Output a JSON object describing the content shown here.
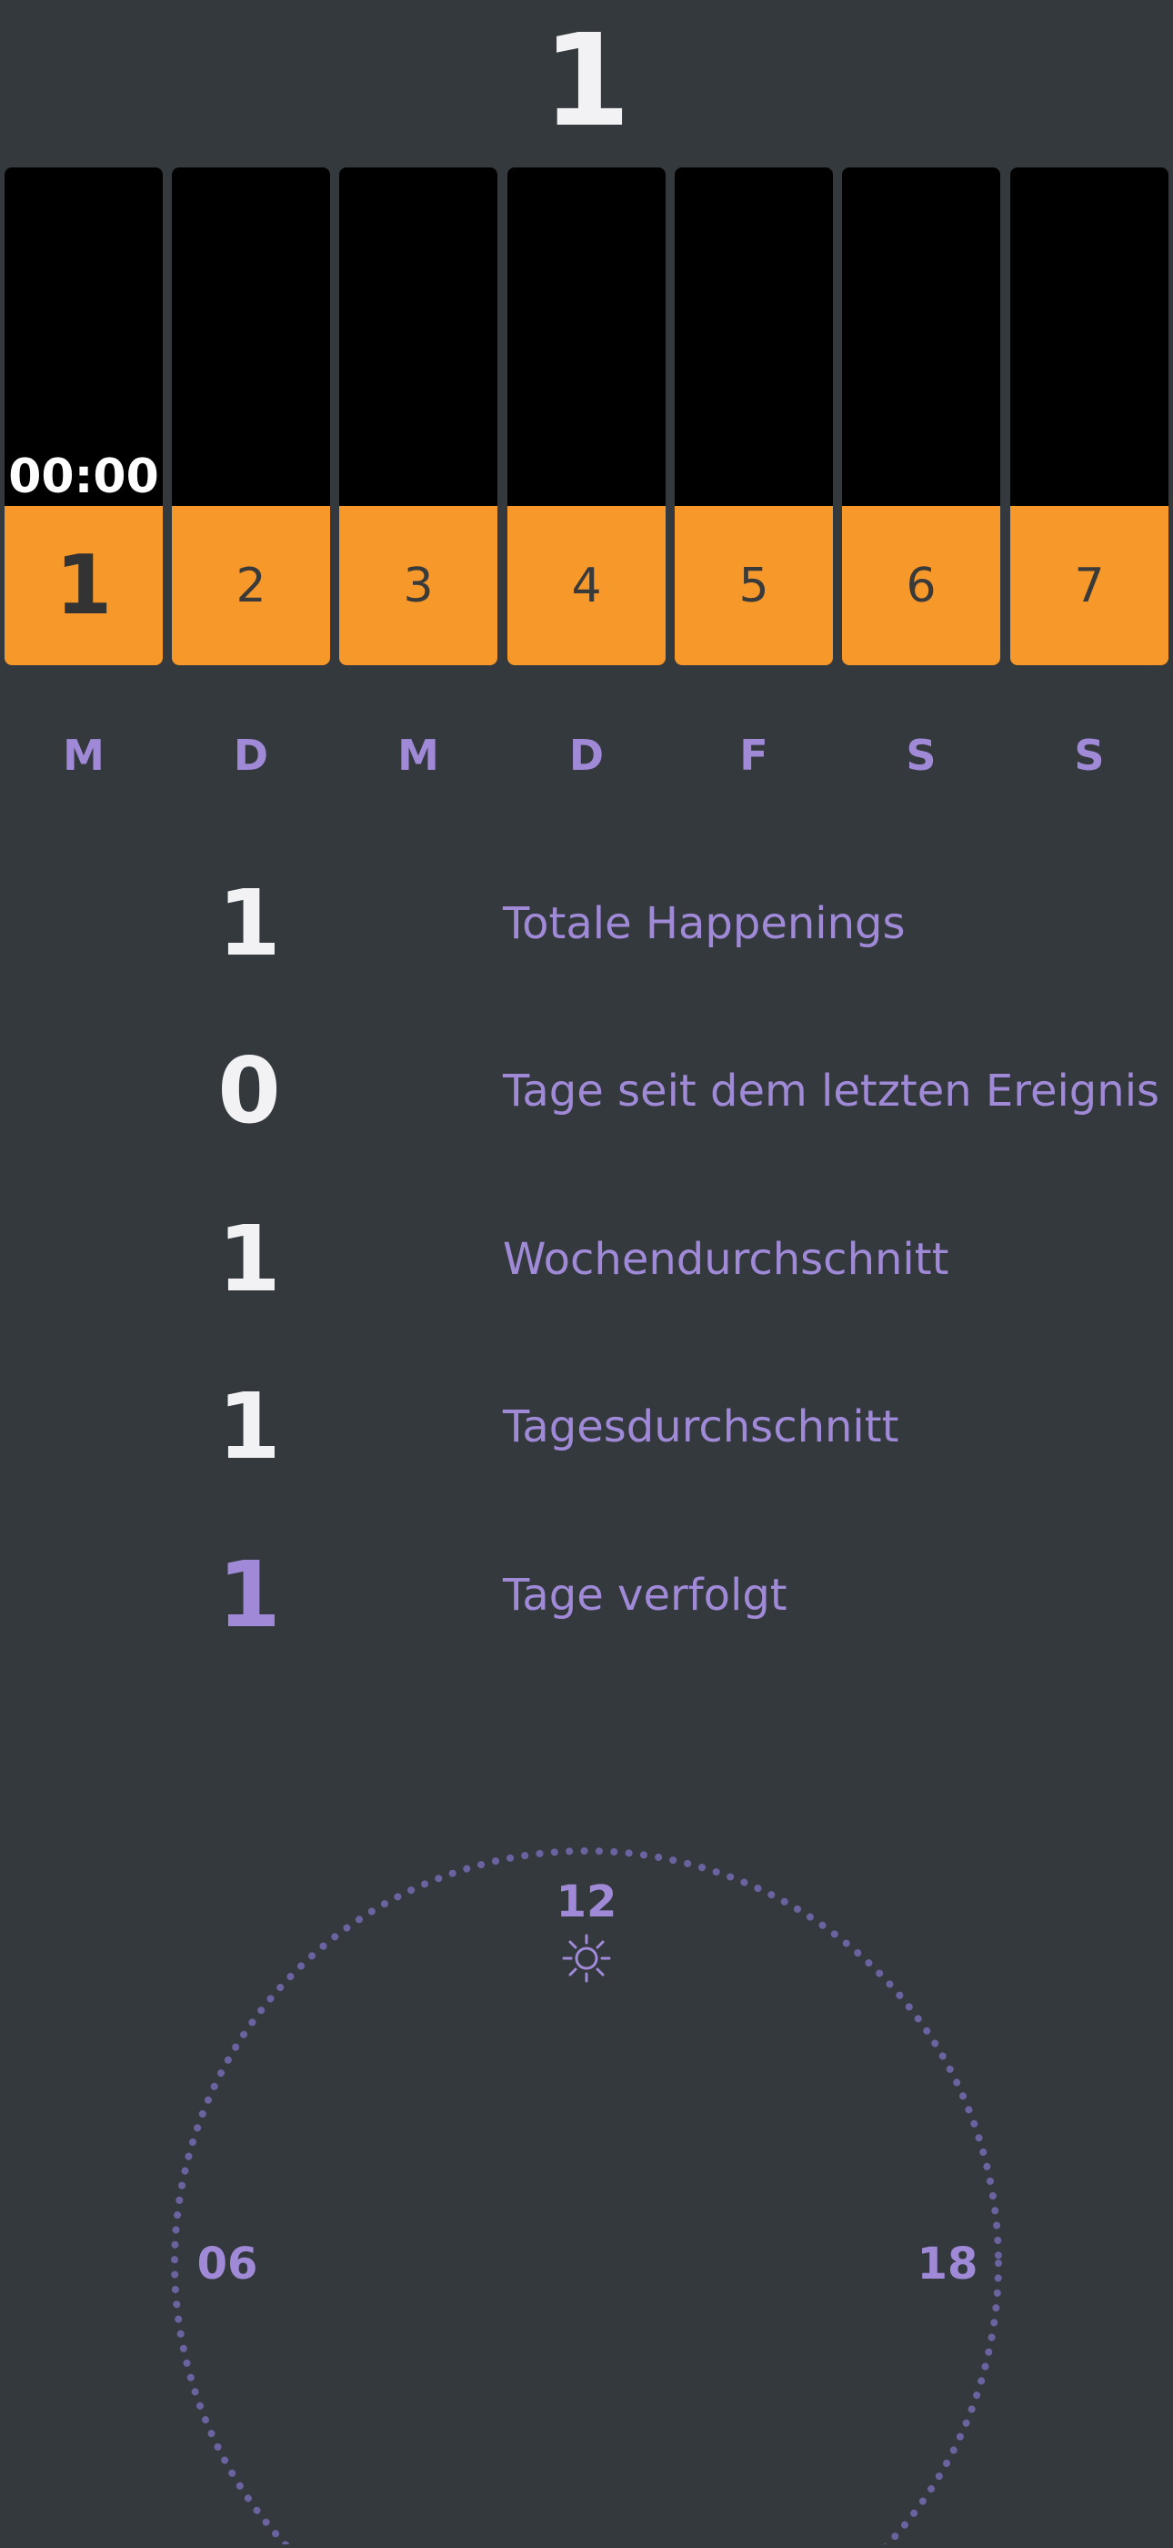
{
  "header": {
    "count": "1"
  },
  "week": {
    "active_time": "00:00",
    "days": [
      {
        "number": "1",
        "weekday": "M",
        "fill": 0.32
      },
      {
        "number": "2",
        "weekday": "D",
        "fill": 0.32
      },
      {
        "number": "3",
        "weekday": "M",
        "fill": 0.32
      },
      {
        "number": "4",
        "weekday": "D",
        "fill": 0.32
      },
      {
        "number": "5",
        "weekday": "F",
        "fill": 0.32
      },
      {
        "number": "6",
        "weekday": "S",
        "fill": 0.32
      },
      {
        "number": "7",
        "weekday": "S",
        "fill": 0.32
      }
    ]
  },
  "stats": [
    {
      "value": "1",
      "label": "Totale Happenings"
    },
    {
      "value": "0",
      "label": "Tage seit dem letzten Ereignis"
    },
    {
      "value": "1",
      "label": "Wochendurchschnitt"
    },
    {
      "value": "1",
      "label": "Tagesdurchschnitt"
    },
    {
      "value": "1",
      "label": "Tage verfolgt"
    }
  ],
  "dial": {
    "top_label": "12",
    "left_label": "06",
    "right_label": "18",
    "icon": "sun-icon"
  },
  "colors": {
    "background": "#33393d",
    "accent_orange": "#f6992a",
    "accent_purple": "#a08ad8",
    "dial_dots": "#6b63a0",
    "text_white": "#f2f2f4"
  }
}
